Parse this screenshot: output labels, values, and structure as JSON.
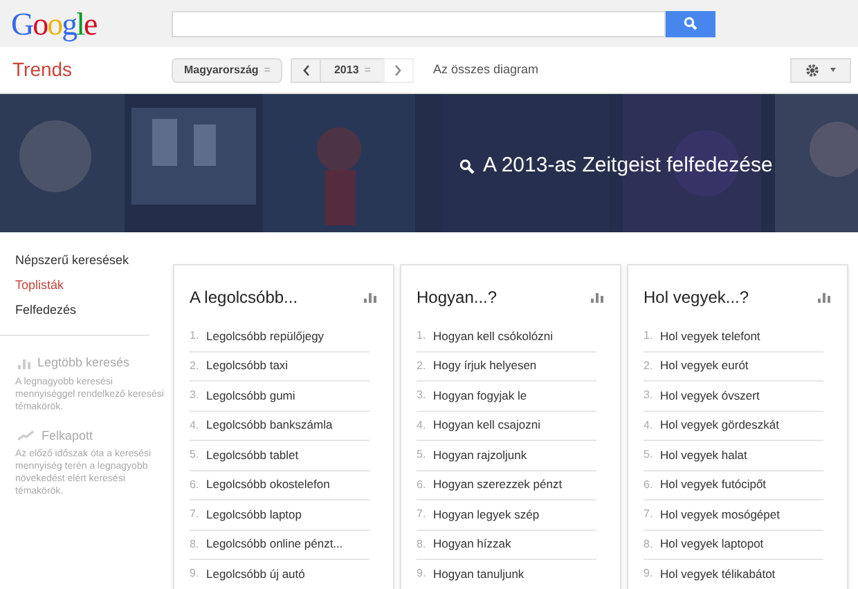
{
  "header": {
    "logo": "Google"
  },
  "toolbar": {
    "app_title": "Trends",
    "region": "Magyarország",
    "region_caret": "=",
    "year": "2013",
    "year_caret": "=",
    "all_charts_link": "Az összes diagram"
  },
  "banner": {
    "title": "A 2013-as Zeitgeist felfedezése"
  },
  "sidebar": {
    "items": [
      {
        "label": "Népszerű keresések",
        "selected": false
      },
      {
        "label": "Toplisták",
        "selected": true
      },
      {
        "label": "Felfedezés",
        "selected": false
      }
    ],
    "info": [
      {
        "kind": "bars",
        "title": "Legtöbb keresés",
        "text": "A legnagyobb keresési mennyiséggel rendelkező keresési témakörök."
      },
      {
        "kind": "trend",
        "title": "Felkapott",
        "text": "Az előző időszak óta a keresési mennyiség terén a legnagyobb növekedést elért keresési témakörök."
      }
    ]
  },
  "cards": [
    {
      "title": "A legolcsóbb...",
      "items": [
        {
          "rank": "1.",
          "label": "Legolcsóbb repülőjegy"
        },
        {
          "rank": "2.",
          "label": "Legolcsóbb taxi"
        },
        {
          "rank": "3.",
          "label": "Legolcsóbb gumi"
        },
        {
          "rank": "4.",
          "label": "Legolcsóbb bankszámla"
        },
        {
          "rank": "5.",
          "label": "Legolcsóbb tablet"
        },
        {
          "rank": "6.",
          "label": "Legolcsóbb okostelefon"
        },
        {
          "rank": "7.",
          "label": "Legolcsóbb laptop"
        },
        {
          "rank": "8.",
          "label": "Legolcsóbb online pénzt..."
        },
        {
          "rank": "9.",
          "label": "Legolcsóbb új autó"
        }
      ]
    },
    {
      "title": "Hogyan...?",
      "items": [
        {
          "rank": "1.",
          "label": "Hogyan kell csókolózni"
        },
        {
          "rank": "2.",
          "label": "Hogy írjuk helyesen"
        },
        {
          "rank": "3.",
          "label": "Hogyan fogyjak le"
        },
        {
          "rank": "4.",
          "label": "Hogyan kell csajozni"
        },
        {
          "rank": "5.",
          "label": "Hogyan rajzoljunk"
        },
        {
          "rank": "6.",
          "label": "Hogyan szerezzek pénzt"
        },
        {
          "rank": "7.",
          "label": "Hogyan legyek szép"
        },
        {
          "rank": "8.",
          "label": "Hogyan hízzak"
        },
        {
          "rank": "9.",
          "label": "Hogyan tanuljunk"
        }
      ]
    },
    {
      "title": "Hol vegyek...?",
      "items": [
        {
          "rank": "1.",
          "label": "Hol vegyek telefont"
        },
        {
          "rank": "2.",
          "label": "Hol vegyek eurót"
        },
        {
          "rank": "3.",
          "label": "Hol vegyek óvszert"
        },
        {
          "rank": "4.",
          "label": "Hol vegyek gördeszkát"
        },
        {
          "rank": "5.",
          "label": "Hol vegyek halat"
        },
        {
          "rank": "6.",
          "label": "Hol vegyek futócipőt"
        },
        {
          "rank": "7.",
          "label": "Hol vegyek mosógépet"
        },
        {
          "rank": "8.",
          "label": "Hol vegyek laptopot"
        },
        {
          "rank": "9.",
          "label": "Hol vegyek télikabátot"
        }
      ]
    }
  ]
}
